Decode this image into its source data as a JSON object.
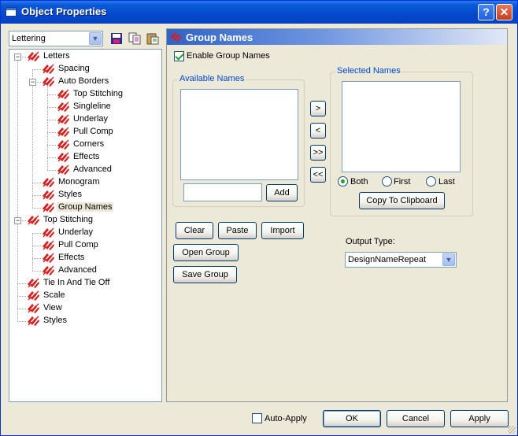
{
  "window": {
    "title": "Object Properties",
    "help_symbol": "?",
    "close_symbol": "✕"
  },
  "left": {
    "object_select": {
      "value": "Lettering"
    },
    "toolbar_icons": [
      "save-icon",
      "copy-icon",
      "paste-icon"
    ],
    "tree": [
      {
        "label": "Letters",
        "icon": "thread-icon",
        "expander": "−"
      },
      {
        "label": "Spacing",
        "icon": "thread-icon"
      },
      {
        "label": "Auto Borders",
        "icon": "thread-icon",
        "expander": "−"
      },
      {
        "label": "Top Stitching",
        "icon": "thread-icon"
      },
      {
        "label": "Singleline",
        "icon": "thread-icon"
      },
      {
        "label": "Underlay",
        "icon": "thread-icon"
      },
      {
        "label": "Pull Comp",
        "icon": "thread-icon"
      },
      {
        "label": "Corners",
        "icon": "thread-icon"
      },
      {
        "label": "Effects",
        "icon": "thread-icon"
      },
      {
        "label": "Advanced",
        "icon": "thread-icon"
      },
      {
        "label": "Monogram",
        "icon": "thread-icon"
      },
      {
        "label": "Styles",
        "icon": "thread-icon"
      },
      {
        "label": "Group Names",
        "icon": "thread-icon",
        "selected": true
      },
      {
        "label": "Top Stitching",
        "icon": "thread-icon",
        "expander": "−"
      },
      {
        "label": "Underlay",
        "icon": "thread-icon"
      },
      {
        "label": "Pull Comp",
        "icon": "thread-icon"
      },
      {
        "label": "Effects",
        "icon": "thread-icon"
      },
      {
        "label": "Advanced",
        "icon": "thread-icon"
      },
      {
        "label": "Tie In And Tie Off",
        "icon": "thread-icon"
      },
      {
        "label": "Scale",
        "icon": "thread-icon"
      },
      {
        "label": "View",
        "icon": "thread-icon"
      },
      {
        "label": "Styles",
        "icon": "thread-icon"
      }
    ]
  },
  "panel": {
    "title": "Group Names",
    "enable_checkbox": {
      "label": "Enable Group Names",
      "checked": true
    },
    "available": {
      "legend": "Available Names",
      "input_value": "",
      "add_label": "Add"
    },
    "move_buttons": [
      ">",
      "<",
      ">>",
      "<<"
    ],
    "selected": {
      "legend": "Selected Names"
    },
    "radios": [
      {
        "label": "Both",
        "checked": true
      },
      {
        "label": "First",
        "checked": false
      },
      {
        "label": "Last",
        "checked": false
      }
    ],
    "copy_label": "Copy To Clipboard",
    "clear_label": "Clear",
    "paste_label": "Paste",
    "import_label": "Import",
    "open_group_label": "Open Group",
    "save_group_label": "Save Group",
    "output_type": {
      "label": "Output Type:",
      "value": "DesignNameRepeat"
    }
  },
  "footer": {
    "auto_apply": {
      "label": "Auto-Apply",
      "checked": false
    },
    "ok_label": "OK",
    "cancel_label": "Cancel",
    "apply_label": "Apply"
  },
  "colors": {
    "title_bar": "#0548cc",
    "thread_icon": "#d62020",
    "legend_text": "#0046d5",
    "check_mark": "#21a121"
  }
}
